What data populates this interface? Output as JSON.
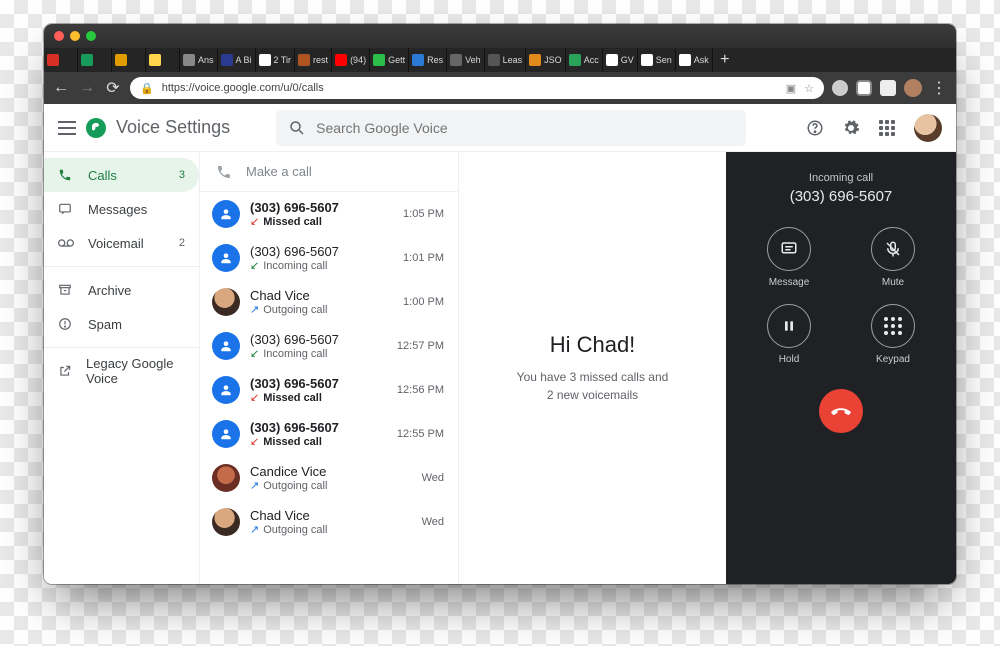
{
  "browser": {
    "traffic_lights": [
      "#ff5f56",
      "#ffbd2e",
      "#27c93f"
    ],
    "tabs": [
      {
        "favicon": "#d93025",
        "label": ""
      },
      {
        "favicon": "#169b5a",
        "label": ""
      },
      {
        "favicon": "#e09b00",
        "label": ""
      },
      {
        "favicon": "#ffd54f",
        "label": ""
      },
      {
        "favicon": "#888888",
        "label": "Ans"
      },
      {
        "favicon": "#2a3b8f",
        "label": "A Bi"
      },
      {
        "favicon": "#ffffff",
        "label": "2 Tir"
      },
      {
        "favicon": "#b05522",
        "label": "rest"
      },
      {
        "favicon": "#ff0000",
        "label": "(94)"
      },
      {
        "favicon": "#2bbf4a",
        "label": "Gett"
      },
      {
        "favicon": "#2a7ad4",
        "label": "Res"
      },
      {
        "favicon": "#666666",
        "label": "Veh"
      },
      {
        "favicon": "#555555",
        "label": "Leas"
      },
      {
        "favicon": "#e08a1e",
        "label": "JSO"
      },
      {
        "favicon": "#2aa35a",
        "label": "Acc"
      },
      {
        "favicon": "#ffffff",
        "label": "GV"
      },
      {
        "favicon": "#ffffff",
        "label": "Sen"
      },
      {
        "favicon": "#ffffff",
        "label": "Ask"
      }
    ],
    "url": "https://voice.google.com/u/0/calls"
  },
  "header": {
    "app_name_1": "Voice",
    "app_name_2": "Settings",
    "search_placeholder": "Search Google Voice"
  },
  "sidebar": {
    "items": [
      {
        "icon": "phone",
        "label": "Calls",
        "count": "3"
      },
      {
        "icon": "message",
        "label": "Messages",
        "count": ""
      },
      {
        "icon": "voicemail",
        "label": "Voicemail",
        "count": "2"
      }
    ],
    "items2": [
      {
        "icon": "archive",
        "label": "Archive"
      },
      {
        "icon": "spam",
        "label": "Spam"
      }
    ],
    "items3": [
      {
        "icon": "launch",
        "label": "Legacy Google Voice"
      }
    ]
  },
  "calls": {
    "make_label": "Make a call",
    "list": [
      {
        "avatar": "generic",
        "title": "(303) 696-5607",
        "title_bold": true,
        "type": "missed",
        "type_label": "Missed call",
        "type_bold": true,
        "time": "1:05 PM"
      },
      {
        "avatar": "generic",
        "title": "(303) 696-5607",
        "title_bold": false,
        "type": "in",
        "type_label": "Incoming call",
        "type_bold": false,
        "time": "1:01 PM"
      },
      {
        "avatar": "photo1",
        "title": "Chad Vice",
        "title_bold": false,
        "type": "out",
        "type_label": "Outgoing call",
        "type_bold": false,
        "time": "1:00 PM"
      },
      {
        "avatar": "generic",
        "title": "(303) 696-5607",
        "title_bold": false,
        "type": "in",
        "type_label": "Incoming call",
        "type_bold": false,
        "time": "12:57 PM"
      },
      {
        "avatar": "generic",
        "title": "(303) 696-5607",
        "title_bold": true,
        "type": "missed",
        "type_label": "Missed call",
        "type_bold": true,
        "time": "12:56 PM"
      },
      {
        "avatar": "generic",
        "title": "(303) 696-5607",
        "title_bold": true,
        "type": "missed",
        "type_label": "Missed call",
        "type_bold": true,
        "time": "12:55 PM"
      },
      {
        "avatar": "photo2",
        "title": "Candice Vice",
        "title_bold": false,
        "type": "out",
        "type_label": "Outgoing call",
        "type_bold": false,
        "time": "Wed"
      },
      {
        "avatar": "photo1",
        "title": "Chad Vice",
        "title_bold": false,
        "type": "out",
        "type_label": "Outgoing call",
        "type_bold": false,
        "time": "Wed"
      }
    ]
  },
  "greet": {
    "heading": "Hi Chad!",
    "sub": "You have 3 missed calls and 2 new voicemails"
  },
  "dialer": {
    "sub": "Incoming call",
    "number": "(303) 696-5607",
    "buttons": [
      {
        "name": "message",
        "label": "Message"
      },
      {
        "name": "mute",
        "label": "Mute"
      },
      {
        "name": "hold",
        "label": "Hold"
      },
      {
        "name": "keypad",
        "label": "Keypad"
      }
    ]
  }
}
